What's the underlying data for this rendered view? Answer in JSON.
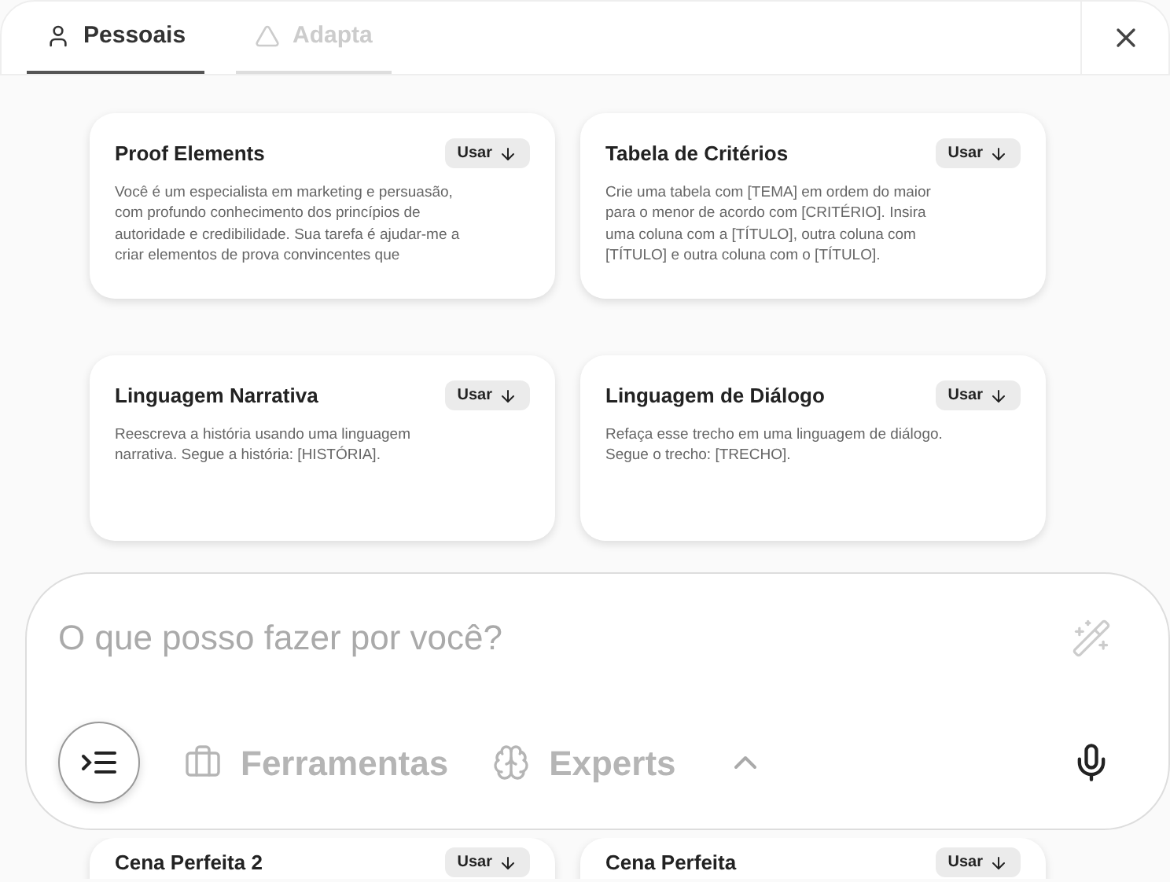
{
  "tabs": [
    {
      "label": "Pessoais",
      "selected": true
    },
    {
      "label": "Adapta",
      "selected": false
    }
  ],
  "cards": [
    {
      "title": "Proof Elements",
      "description": "Você é um especialista em marketing e persuasão, com profundo conhecimento dos princípios de autoridade e credibilidade. Sua tarefa é ajudar-me a criar elementos de prova convincentes que",
      "button": "Usar"
    },
    {
      "title": "Tabela de Critérios",
      "description": "Crie uma tabela com [TEMA] em ordem do maior para o menor de acordo com [CRITÉRIO]. Insira uma coluna com a [TÍTULO], outra coluna com [TÍTULO] e outra coluna com o [TÍTULO].",
      "button": "Usar"
    },
    {
      "title": "Linguagem Narrativa",
      "description": "Reescreva a história usando uma linguagem narrativa. Segue a história: [HISTÓRIA].",
      "button": "Usar"
    },
    {
      "title": "Linguagem de Diálogo",
      "description": "Refaça esse trecho em uma linguagem de diálogo. Segue o trecho: [TRECHO].",
      "button": "Usar"
    }
  ],
  "composer": {
    "placeholder": "O que posso fazer por você?",
    "tools": [
      {
        "label": "Ferramentas"
      },
      {
        "label": "Experts"
      }
    ]
  },
  "cards_below": [
    {
      "title": "Cena Perfeita 2",
      "button": "Usar"
    },
    {
      "title": "Cena Perfeita",
      "button": "Usar"
    }
  ]
}
